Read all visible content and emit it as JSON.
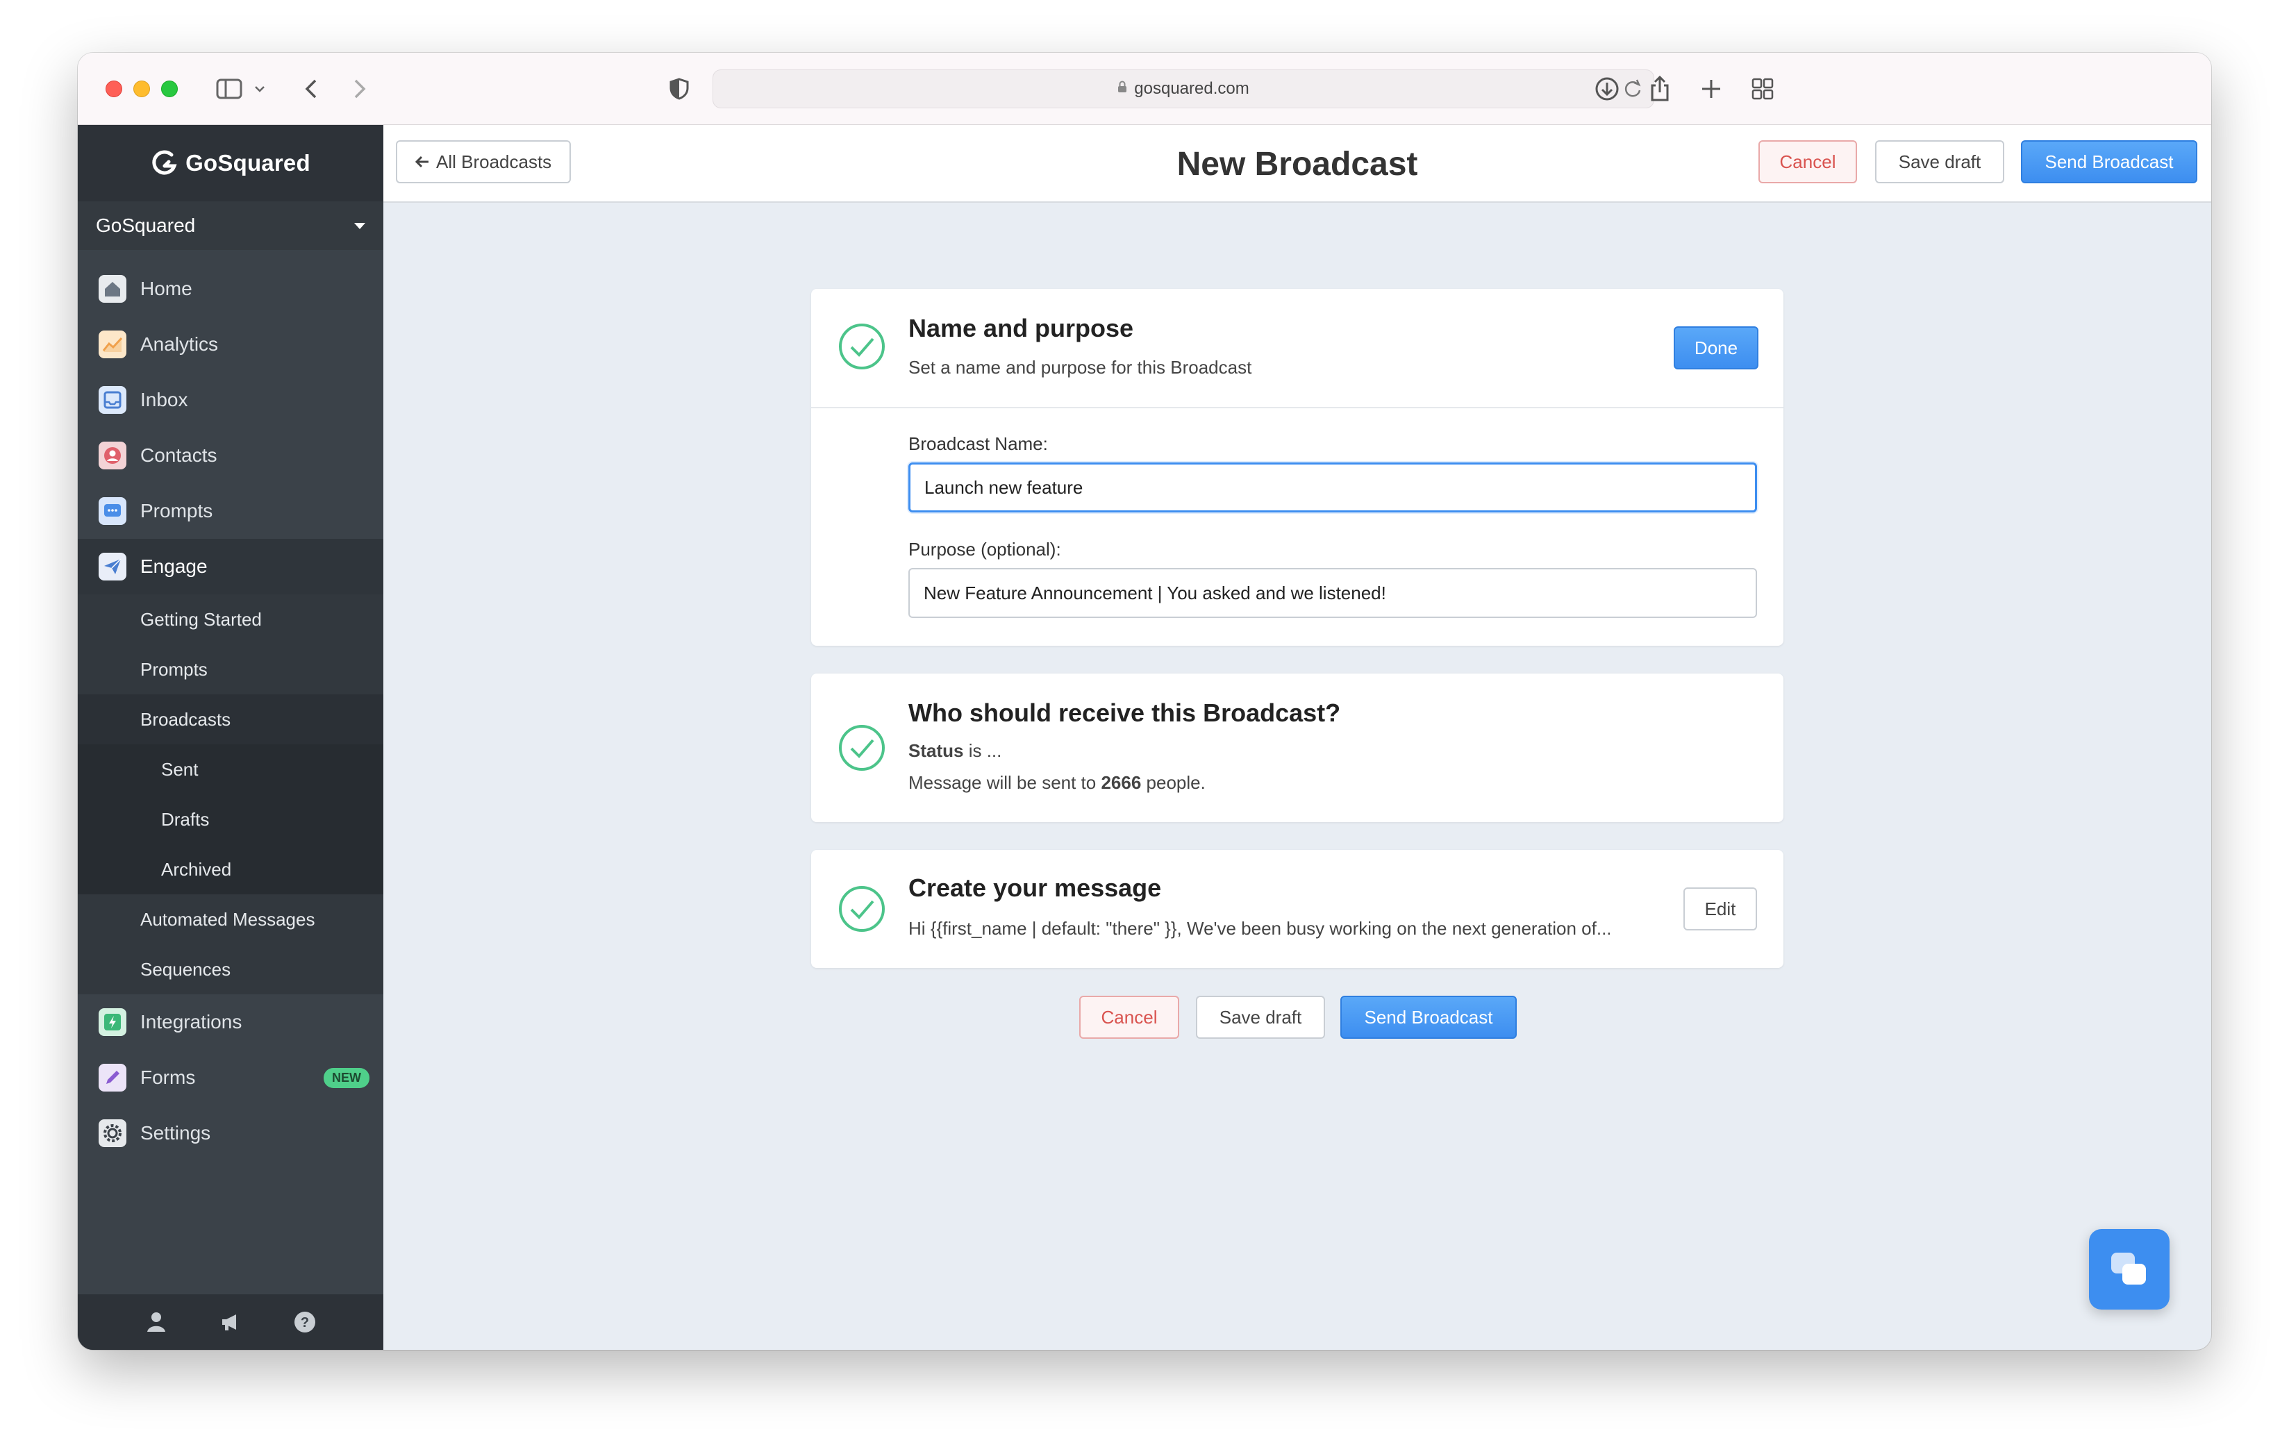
{
  "browser": {
    "url": "gosquared.com"
  },
  "sidebar": {
    "brand": "GoSquared",
    "account": "GoSquared",
    "nav": [
      {
        "label": "Home"
      },
      {
        "label": "Analytics"
      },
      {
        "label": "Inbox"
      },
      {
        "label": "Contacts"
      },
      {
        "label": "Prompts"
      },
      {
        "label": "Engage"
      }
    ],
    "engage_sub": [
      "Getting Started",
      "Prompts",
      "Broadcasts"
    ],
    "broadcasts_sub": [
      "Sent",
      "Drafts",
      "Archived"
    ],
    "engage_sub2": [
      "Automated Messages",
      "Sequences"
    ],
    "nav2": [
      {
        "label": "Integrations"
      },
      {
        "label": "Forms"
      },
      {
        "label": "Settings"
      }
    ],
    "forms_badge": "NEW"
  },
  "header": {
    "back_label": "All Broadcasts",
    "title": "New Broadcast",
    "cancel_label": "Cancel",
    "save_label": "Save draft",
    "send_label": "Send Broadcast"
  },
  "name_card": {
    "title": "Name and purpose",
    "subtitle": "Set a name and purpose for this Broadcast",
    "done_label": "Done",
    "name_label": "Broadcast Name:",
    "name_value": "Launch new feature",
    "purpose_label": "Purpose (optional):",
    "purpose_value": "New Feature Announcement | You asked and we listened!"
  },
  "recipients_card": {
    "title": "Who should receive this Broadcast?",
    "status_strong": "Status",
    "status_rest": " is ...",
    "message_prefix": "Message will be sent to ",
    "count": "2666",
    "message_suffix": " people."
  },
  "message_card": {
    "title": "Create your message",
    "preview": "Hi {{first_name | default: \"there\" }}, We've been busy working on the next generation of...",
    "edit_label": "Edit"
  },
  "footer_buttons": {
    "cancel_label": "Cancel",
    "save_label": "Save draft",
    "send_label": "Send Broadcast"
  },
  "colors": {
    "primary": "#3d8ef0",
    "danger": "#d9534f",
    "success": "#4cc48a",
    "sidebar": "#3b4249"
  }
}
